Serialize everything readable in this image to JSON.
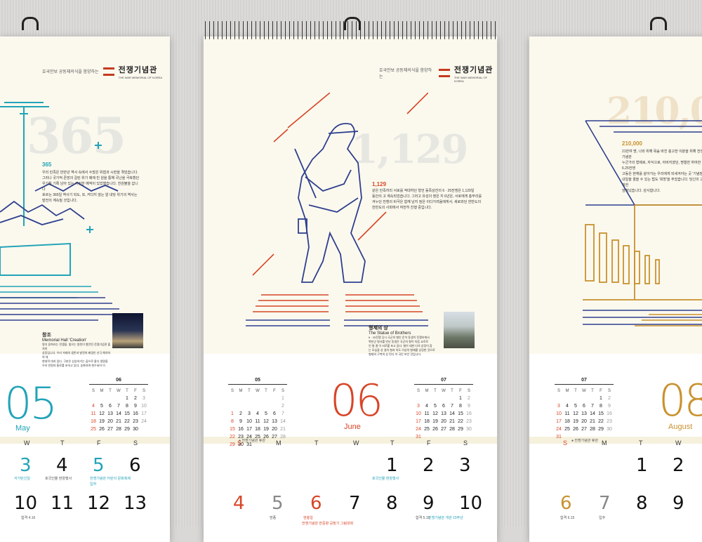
{
  "left_page": {
    "logo_tagline": "호국안보 공동체의식을 함양하는",
    "logo_name": "전쟁기념관",
    "logo_sub": "THE WAR MEMORIAL OF KOREA",
    "big_number": "365",
    "heading": "365",
    "body": [
      "우리 민족은 반만년 역사 속에서 수많은 위협과 시련을 겪었습니다.",
      "그러나 국가적 존망의 갈린 위기 때에 빈 원을 통해 국난을 극복했던",
      "우기들 기록 남아 있는 이런한 예적이 있었했습니다. 천원불을 갑니다",
      "호르는 365일 역사기 되도, 또, 커다지 않는 알 내당 위기의 역사는",
      "발전의 계속될 것입니다."
    ],
    "caption_title": "창조",
    "caption_sub": "Memorial Hall 'Creation'",
    "caption_body": [
      "명석 류희라는 전쟁을, 빛으는 원천이 형언된 전쟁기념관 출처의",
      "상장입니다. 우리 겨레의 생존과 발전의 배경인 신극 해석하여 대",
      "현대적 대지 입다. 구분은 상승하기는 꿈으로 올다 생명을",
      "우러 반원의 통로를 포속고 있다, 승화하여 현수되어 이"
    ],
    "minical": {
      "title": "06",
      "head": [
        "S",
        "M",
        "T",
        "W",
        "T",
        "F",
        "S"
      ],
      "rows": [
        [
          "",
          "",
          "",
          "",
          "1",
          "2",
          "3"
        ],
        [
          "4",
          "5",
          "6",
          "7",
          "8",
          "9",
          "10"
        ],
        [
          "11",
          "12",
          "13",
          "14",
          "15",
          "16",
          "17"
        ],
        [
          "18",
          "19",
          "20",
          "21",
          "22",
          "23",
          "24"
        ],
        [
          "25",
          "26",
          "27",
          "28",
          "29",
          "30",
          ""
        ]
      ]
    },
    "month_num": "05",
    "month_name": "May",
    "weekdays": [
      "W",
      "T",
      "F",
      "S"
    ],
    "days_row1": [
      "3",
      "4",
      "5",
      "6"
    ],
    "days_row2": [
      "10",
      "11",
      "12",
      "13"
    ],
    "notes_row1": [
      "석가탄신일",
      "호국인물 현양행사",
      "전쟁기념관 어린이 문화축제",
      "입하"
    ],
    "notes_row2": [
      "합격 4.16"
    ]
  },
  "center_page": {
    "logo_tagline": "호국안보 공동체의식을 함양하는",
    "logo_name": "전쟁기념관",
    "logo_sub": "THE WAR MEMORIAL OF KOREA",
    "big_number": "1,129",
    "heading": "1,129",
    "body": [
      "같은 민족끼리 서로를 적대하던 형언 동족상잔의 6 · 25전쟁은 1,129일",
      "동안의 고 계속되었습니다. 그러고 유성의 영은 지 6년은, 서로에게 총부리를",
      "겨누던 전쟁의 비극은 함께 남지 짐은 이다가려움에게서, 새로와던 한반도의",
      "한반도의 사회에서 여전히 진행 중입니다."
    ],
    "caption_title": "형제의 상",
    "caption_sub": "The Statue of Brothers",
    "caption_body": [
      "6 · 25전쟁 당시 국군의 형인 운석 동생이 전쟁터에서",
      "북한군 병사를 만난 동생은 국군의 형이 처음 교로로",
      "인 형 결 이 서로를 포고 있다. 형이 대한 다의 상징이 잡",
      "는 모습을 상 생의 형과 의도 이상의 형제를 상징한 것으로",
      "형제의 구복의 상 된다 이 국인 보인 것입니다."
    ],
    "minical_left": {
      "title": "05",
      "head": [
        "S",
        "M",
        "T",
        "W",
        "T",
        "F",
        "S"
      ],
      "rows": [
        [
          "",
          "",
          "",
          "",
          "",
          "",
          "1"
        ],
        [
          "",
          "",
          "",
          "",
          "",
          "",
          "2"
        ],
        [
          "1",
          "2",
          "3",
          "4",
          "5",
          "6",
          "7"
        ],
        [
          "8",
          "9",
          "10",
          "11",
          "12",
          "13",
          "14"
        ],
        [
          "15",
          "16",
          "17",
          "18",
          "19",
          "20",
          "21"
        ],
        [
          "22",
          "23",
          "24",
          "25",
          "26",
          "27",
          "28"
        ],
        [
          "29",
          "30",
          "31",
          "",
          "",
          "",
          ""
        ]
      ]
    },
    "minical_right": {
      "title": "07",
      "head": [
        "S",
        "M",
        "T",
        "W",
        "T",
        "F",
        "S"
      ],
      "rows": [
        [
          "",
          "",
          "",
          "",
          "",
          "1",
          "2"
        ],
        [
          "3",
          "4",
          "5",
          "6",
          "7",
          "8",
          "9"
        ],
        [
          "10",
          "11",
          "12",
          "13",
          "14",
          "15",
          "16"
        ],
        [
          "17",
          "18",
          "19",
          "20",
          "21",
          "22",
          "23"
        ],
        [
          "24",
          "25",
          "26",
          "27",
          "28",
          "29",
          "30"
        ],
        [
          "31",
          "",
          "",
          "",
          "",
          "",
          ""
        ]
      ]
    },
    "month_num": "06",
    "month_name": "June",
    "closed_note": "● 전쟁기념관 휴관",
    "weekdays": [
      "S",
      "M",
      "T",
      "W",
      "T",
      "F",
      "S"
    ],
    "days_row1": [
      "1",
      "2",
      "3"
    ],
    "days_row2": [
      "4",
      "5",
      "6",
      "7",
      "8",
      "9",
      "10"
    ],
    "notes_row1": [
      "호국인물 현양행사"
    ],
    "notes_row2": [
      "망종",
      "현충일",
      "전쟁기념관 한중항 공청기 그림대회",
      "합격 5.15",
      "전쟁기념관 개관 23주년"
    ]
  },
  "right_page": {
    "big_number": "210,0",
    "heading": "210,000",
    "body": [
      "21만여 명, 나와 위해 목숨 바친 충고한 이분을 위해 전쟁기념관",
      "누군가의 형제로, 자식으로, 아버지였던, 명렬한 하여한 6.25전쟁",
      "고동은 현재를 살아가는 우리에게 되새겨야는 곳 '기념장'",
      "내일을 꿈을 수 있는 법도 '희망'을 주었습니다. 당신의 고귀한",
      "엄청났습니다. 감사합니다."
    ],
    "minical": {
      "title": "07",
      "head": [
        "S",
        "M",
        "T",
        "W",
        "T",
        "F",
        "S"
      ],
      "rows": [
        [
          "",
          "",
          "",
          "",
          "",
          "1",
          "2"
        ],
        [
          "3",
          "4",
          "5",
          "6",
          "7",
          "8",
          "9"
        ],
        [
          "10",
          "11",
          "12",
          "13",
          "14",
          "15",
          "16"
        ],
        [
          "17",
          "18",
          "19",
          "20",
          "21",
          "22",
          "23"
        ],
        [
          "24",
          "25",
          "26",
          "27",
          "28",
          "29",
          "30"
        ],
        [
          "31",
          "",
          "",
          "",
          "",
          "",
          ""
        ]
      ]
    },
    "month_num": "08",
    "month_name": "August",
    "closed_note": "● 전쟁기념관 휴관",
    "weekdays": [
      "S",
      "M",
      "T",
      "W"
    ],
    "days_row1": [
      "1",
      "2"
    ],
    "days_row2": [
      "6",
      "7",
      "8",
      "9"
    ],
    "notes_row2": [
      "합격 6.15",
      "입추"
    ]
  },
  "colors": {
    "teal": "#22a3b8",
    "red": "#d84527",
    "navy": "#2f3f8f",
    "gold": "#c9912e"
  }
}
